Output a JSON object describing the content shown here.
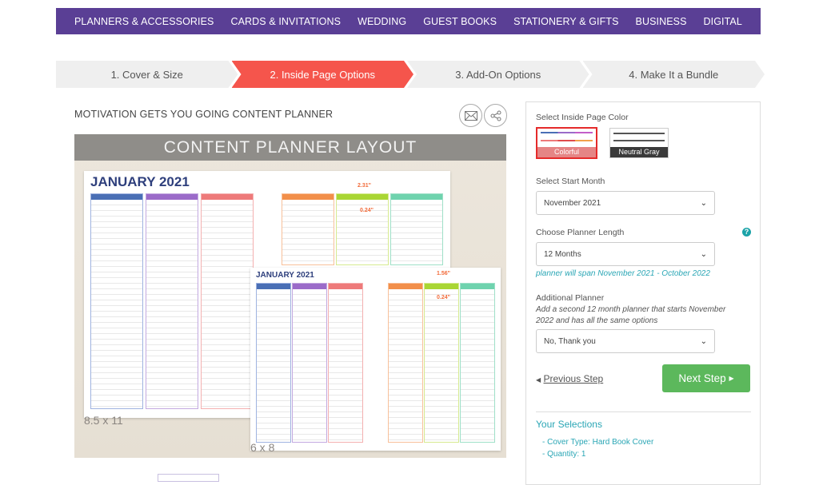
{
  "nav": {
    "items": [
      "PLANNERS & ACCESSORIES",
      "CARDS & INVITATIONS",
      "WEDDING",
      "GUEST BOOKS",
      "STATIONERY & GIFTS",
      "BUSINESS",
      "DIGITAL"
    ],
    "color": "#5a3f95"
  },
  "steps": [
    {
      "label": "1. Cover & Size",
      "active": false
    },
    {
      "label": "2. Inside Page Options",
      "active": true
    },
    {
      "label": "3. Add-On Options",
      "active": false
    },
    {
      "label": "4. Make It a Bundle",
      "active": false
    }
  ],
  "product": {
    "title": "MOTIVATION GETS YOU GOING CONTENT PLANNER",
    "icons": [
      "email-icon",
      "share-icon"
    ]
  },
  "image": {
    "heading": "CONTENT PLANNER LAYOUT",
    "large": {
      "month": "JANUARY 2021",
      "size": "8.5 x 11",
      "width": "2.31\"",
      "height": "0.24\""
    },
    "small": {
      "month": "JANUARY 2021",
      "size": "6 x 8",
      "width": "1.56\"",
      "height": "0.24\""
    }
  },
  "options": {
    "color_label": "Select Inside Page Color",
    "colors": [
      {
        "label": "Colorful",
        "selected": true
      },
      {
        "label": "Neutral Gray",
        "selected": false
      }
    ],
    "start_label": "Select Start Month",
    "start_value": "November 2021",
    "length_label": "Choose Planner Length",
    "length_value": "12 Months",
    "span_note": "planner will span November 2021 - October 2022",
    "additional_label": "Additional Planner",
    "additional_desc": "Add a second 12 month planner that starts November 2022 and has all the same options",
    "additional_value": "No, Thank you",
    "prev": "Previous Step",
    "next": "Next Step",
    "selections_title": "Your Selections",
    "selections": [
      "- Cover Type: Hard Book Cover",
      "- Quantity: 1"
    ]
  },
  "colors": {
    "accent": "#f5554c",
    "next": "#5cb85c",
    "teal": "#2aa6b5"
  }
}
